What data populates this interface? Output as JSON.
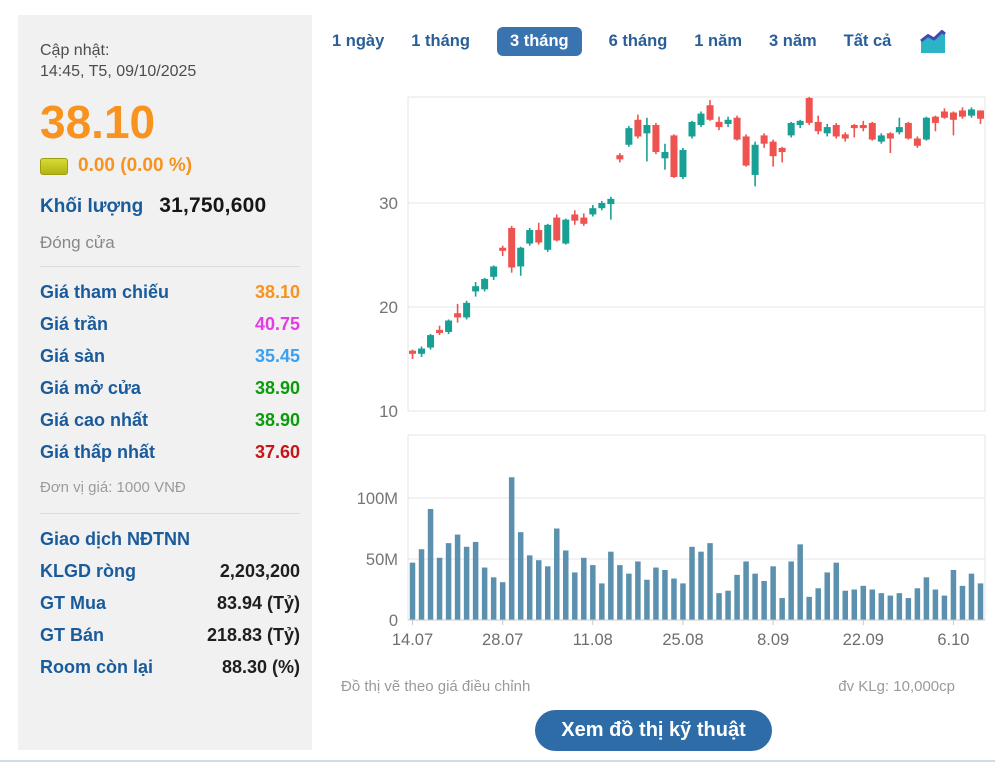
{
  "sidebar": {
    "updated_label": "Cập nhật:",
    "updated_time": "14:45, T5, 09/10/2025",
    "price": "38.10",
    "change_text": "0.00 (0.00 %)",
    "volume_label": "Khối lượng",
    "volume_value": "31,750,600",
    "session_status": "Đóng cửa",
    "price_rows": [
      {
        "label": "Giá tham chiếu",
        "value": "38.10",
        "color": "#f7931e"
      },
      {
        "label": "Giá trần",
        "value": "40.75",
        "color": "#e43be4"
      },
      {
        "label": "Giá sàn",
        "value": "35.45",
        "color": "#3ba1ef"
      },
      {
        "label": "Giá mở cửa",
        "value": "38.90",
        "color": "#0b9b0b"
      },
      {
        "label": "Giá cao nhất",
        "value": "38.90",
        "color": "#0b9b0b"
      },
      {
        "label": "Giá thấp nhất",
        "value": "37.60",
        "color": "#c81414"
      }
    ],
    "unit_note": "Đơn vị giá: 1000 VNĐ",
    "foreign_header": "Giao dịch NĐTNN",
    "foreign_rows": [
      {
        "label": "KLGD ròng",
        "value": "2,203,200"
      },
      {
        "label": "GT Mua",
        "value": "83.94 (Tỷ)"
      },
      {
        "label": "GT Bán",
        "value": "218.83 (Tỷ)"
      },
      {
        "label": "Room còn lại",
        "value": "88.30 (%)"
      }
    ]
  },
  "tabs": {
    "items": [
      "1 ngày",
      "1 tháng",
      "3 tháng",
      "6 tháng",
      "1 năm",
      "3 năm",
      "Tất cả"
    ],
    "active": "3 tháng",
    "chart_type_icon": "area-chart-icon"
  },
  "footer": {
    "left_note": "Đồ thị vẽ theo giá điều chỉnh",
    "right_note": "đv KLg: 10,000cp",
    "button_label": "Xem đồ thị kỹ thuật"
  },
  "chart_data": {
    "type": "candlestick",
    "subtype": "price-with-volume",
    "price_axis": {
      "ticks": [
        30,
        20,
        10
      ],
      "range": [
        10,
        40.2
      ],
      "grid": true
    },
    "volume_axis": {
      "ticks": [
        {
          "label": "100M",
          "v": 100
        },
        {
          "label": "50M",
          "v": 50
        },
        {
          "label": "0",
          "v": 0
        }
      ],
      "range": [
        0,
        151
      ],
      "unit": "million shares"
    },
    "x_ticks": [
      {
        "index": 0,
        "label": "14.07"
      },
      {
        "index": 10,
        "label": "28.07"
      },
      {
        "index": 20,
        "label": "11.08"
      },
      {
        "index": 30,
        "label": "25.08"
      },
      {
        "index": 40,
        "label": "8.09"
      },
      {
        "index": 50,
        "label": "22.09"
      },
      {
        "index": 60,
        "label": "6.10"
      }
    ],
    "colors": {
      "up": "#18a095",
      "down": "#ef5350",
      "volume_bar": "#5b91ae",
      "grid": "#e4e4e4",
      "axis": "#c9c9c9",
      "tick_text": "#757575"
    },
    "candles_format": [
      "date",
      "open",
      "high",
      "low",
      "close",
      "volume_M"
    ],
    "candles": [
      [
        "14.07",
        15.8,
        15.9,
        15.0,
        15.5,
        47
      ],
      [
        "15.07",
        15.5,
        16.2,
        15.2,
        16.0,
        58
      ],
      [
        "16.07",
        16.1,
        17.4,
        15.9,
        17.3,
        91
      ],
      [
        "17.07",
        17.8,
        18.2,
        17.3,
        17.5,
        51
      ],
      [
        "18.07",
        17.6,
        18.8,
        17.4,
        18.7,
        63
      ],
      [
        "21.07",
        19.4,
        20.3,
        18.5,
        19.0,
        70
      ],
      [
        "22.07",
        19.0,
        20.6,
        18.8,
        20.4,
        60
      ],
      [
        "23.07",
        21.5,
        22.4,
        21.0,
        22.0,
        64
      ],
      [
        "24.07",
        21.7,
        22.8,
        21.5,
        22.7,
        43
      ],
      [
        "25.07",
        22.9,
        24.0,
        22.6,
        23.9,
        35
      ],
      [
        "28.07",
        25.7,
        25.9,
        24.9,
        25.4,
        31
      ],
      [
        "29.07",
        27.6,
        27.8,
        23.3,
        23.8,
        117
      ],
      [
        "30.07",
        23.9,
        25.8,
        23.0,
        25.7,
        72
      ],
      [
        "31.07",
        26.1,
        27.6,
        25.9,
        27.4,
        53
      ],
      [
        "01.08",
        27.4,
        28.1,
        26.0,
        26.2,
        49
      ],
      [
        "04.08",
        25.5,
        28.0,
        25.3,
        27.9,
        44
      ],
      [
        "05.08",
        28.6,
        28.9,
        26.3,
        26.4,
        75
      ],
      [
        "06.08",
        26.1,
        28.5,
        26.0,
        28.4,
        57
      ],
      [
        "07.08",
        28.9,
        29.3,
        27.9,
        28.3,
        39
      ],
      [
        "08.08",
        28.6,
        29.0,
        27.8,
        28.0,
        51
      ],
      [
        "11.08",
        28.9,
        29.8,
        28.7,
        29.5,
        45
      ],
      [
        "12.08",
        29.5,
        30.2,
        29.3,
        30.0,
        30
      ],
      [
        "13.08",
        29.9,
        30.6,
        28.4,
        30.4,
        56
      ],
      [
        "14.08",
        34.6,
        34.8,
        33.9,
        34.2,
        45
      ],
      [
        "15.08",
        35.6,
        37.4,
        35.4,
        37.2,
        38
      ],
      [
        "18.08",
        38.0,
        38.5,
        36.2,
        36.4,
        48
      ],
      [
        "19.08",
        36.7,
        38.2,
        34.0,
        37.5,
        33
      ],
      [
        "20.08",
        37.5,
        37.7,
        34.7,
        34.9,
        43
      ],
      [
        "21.08",
        34.3,
        35.7,
        33.2,
        34.9,
        41
      ],
      [
        "22.08",
        36.5,
        36.6,
        32.4,
        32.5,
        34
      ],
      [
        "25.08",
        32.5,
        35.3,
        32.3,
        35.1,
        30
      ],
      [
        "26.08",
        36.4,
        37.9,
        36.2,
        37.8,
        60
      ],
      [
        "27.08",
        37.5,
        38.8,
        37.3,
        38.6,
        56
      ],
      [
        "28.08",
        39.4,
        39.9,
        37.9,
        38.0,
        63
      ],
      [
        "29.08",
        37.8,
        38.3,
        37.0,
        37.3,
        22
      ],
      [
        "01.09",
        37.6,
        38.3,
        37.3,
        38.0,
        24
      ],
      [
        "02.09",
        38.2,
        38.4,
        36.0,
        36.1,
        37
      ],
      [
        "03.09",
        36.4,
        36.6,
        33.5,
        33.6,
        48
      ],
      [
        "04.09",
        32.7,
        35.9,
        31.6,
        35.6,
        38
      ],
      [
        "05.09",
        36.5,
        36.7,
        35.3,
        35.7,
        32
      ],
      [
        "08.09",
        35.9,
        36.1,
        33.5,
        34.5,
        44
      ],
      [
        "09.09",
        35.3,
        35.4,
        33.9,
        34.9,
        18
      ],
      [
        "10.09",
        36.5,
        37.8,
        36.3,
        37.7,
        48
      ],
      [
        "11.09",
        37.5,
        38.0,
        37.2,
        37.9,
        62
      ],
      [
        "12.09",
        40.1,
        40.2,
        37.5,
        37.7,
        19
      ],
      [
        "15.09",
        37.8,
        38.4,
        36.6,
        36.9,
        26
      ],
      [
        "16.09",
        36.7,
        37.6,
        36.4,
        37.3,
        39
      ],
      [
        "17.09",
        37.5,
        37.7,
        36.2,
        36.4,
        47
      ],
      [
        "18.09",
        36.6,
        36.8,
        35.9,
        36.2,
        24
      ],
      [
        "19.09",
        37.5,
        37.6,
        36.3,
        37.2,
        25
      ],
      [
        "22.09",
        37.5,
        37.9,
        36.9,
        37.2,
        28
      ],
      [
        "23.09",
        37.7,
        37.8,
        36.0,
        36.1,
        25
      ],
      [
        "24.09",
        35.9,
        36.7,
        35.7,
        36.5,
        22
      ],
      [
        "25.09",
        36.7,
        36.8,
        34.8,
        36.2,
        20
      ],
      [
        "26.09",
        36.8,
        38.2,
        36.6,
        37.3,
        22
      ],
      [
        "29.09",
        37.7,
        37.8,
        36.1,
        36.2,
        18
      ],
      [
        "30.09",
        36.2,
        36.4,
        35.3,
        35.5,
        26
      ],
      [
        "01.10",
        36.1,
        38.3,
        36.0,
        38.2,
        35
      ],
      [
        "02.10",
        38.3,
        38.4,
        36.9,
        37.7,
        25
      ],
      [
        "03.10",
        38.8,
        39.1,
        38.1,
        38.2,
        20
      ],
      [
        "06.10",
        38.7,
        38.8,
        36.5,
        38.0,
        41
      ],
      [
        "07.10",
        38.9,
        39.2,
        38.1,
        38.3,
        28
      ],
      [
        "08.10",
        38.4,
        39.2,
        38.2,
        39.0,
        38
      ],
      [
        "09.10",
        38.9,
        38.9,
        37.6,
        38.1,
        30
      ]
    ]
  }
}
